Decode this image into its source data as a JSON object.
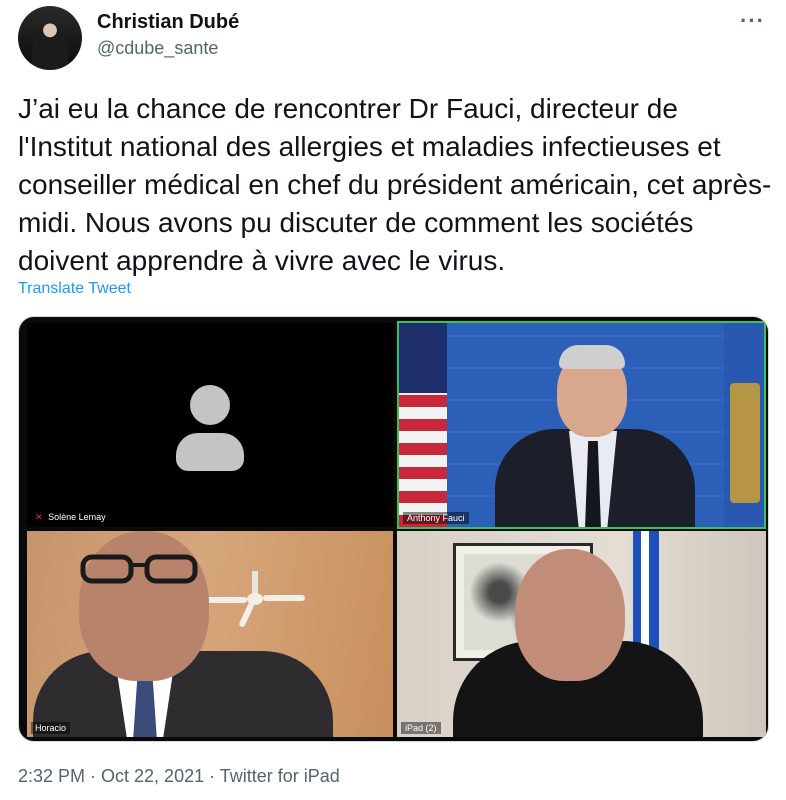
{
  "author": {
    "display_name": "Christian Dubé",
    "handle": "@cdube_sante"
  },
  "more_label": "···",
  "tweet": {
    "text": "J’ai eu la chance de rencontrer Dr Fauci, directeur de l'Institut national des allergies et maladies infectieuses et conseiller médical en chef du président américain, cet après-midi. Nous avons pu discuter de comment les sociétés doivent apprendre à vivre avec le virus.",
    "translate_label": "Translate Tweet"
  },
  "media": {
    "tiles": [
      {
        "participant": "Solène Lemay",
        "muted_icon": "mic-off-icon",
        "video": false
      },
      {
        "participant": "Anthony Fauci",
        "active_speaker": true,
        "highlight_color": "#37c25a"
      },
      {
        "participant": "Horacio"
      },
      {
        "participant": "iPad (2)"
      }
    ]
  },
  "footer": {
    "timestamp": "2:32 PM · Oct 22, 2021 · Twitter for iPad"
  },
  "colors": {
    "link": "#1d9bf0",
    "secondary_text": "#536471",
    "primary_text": "#0f1419"
  }
}
